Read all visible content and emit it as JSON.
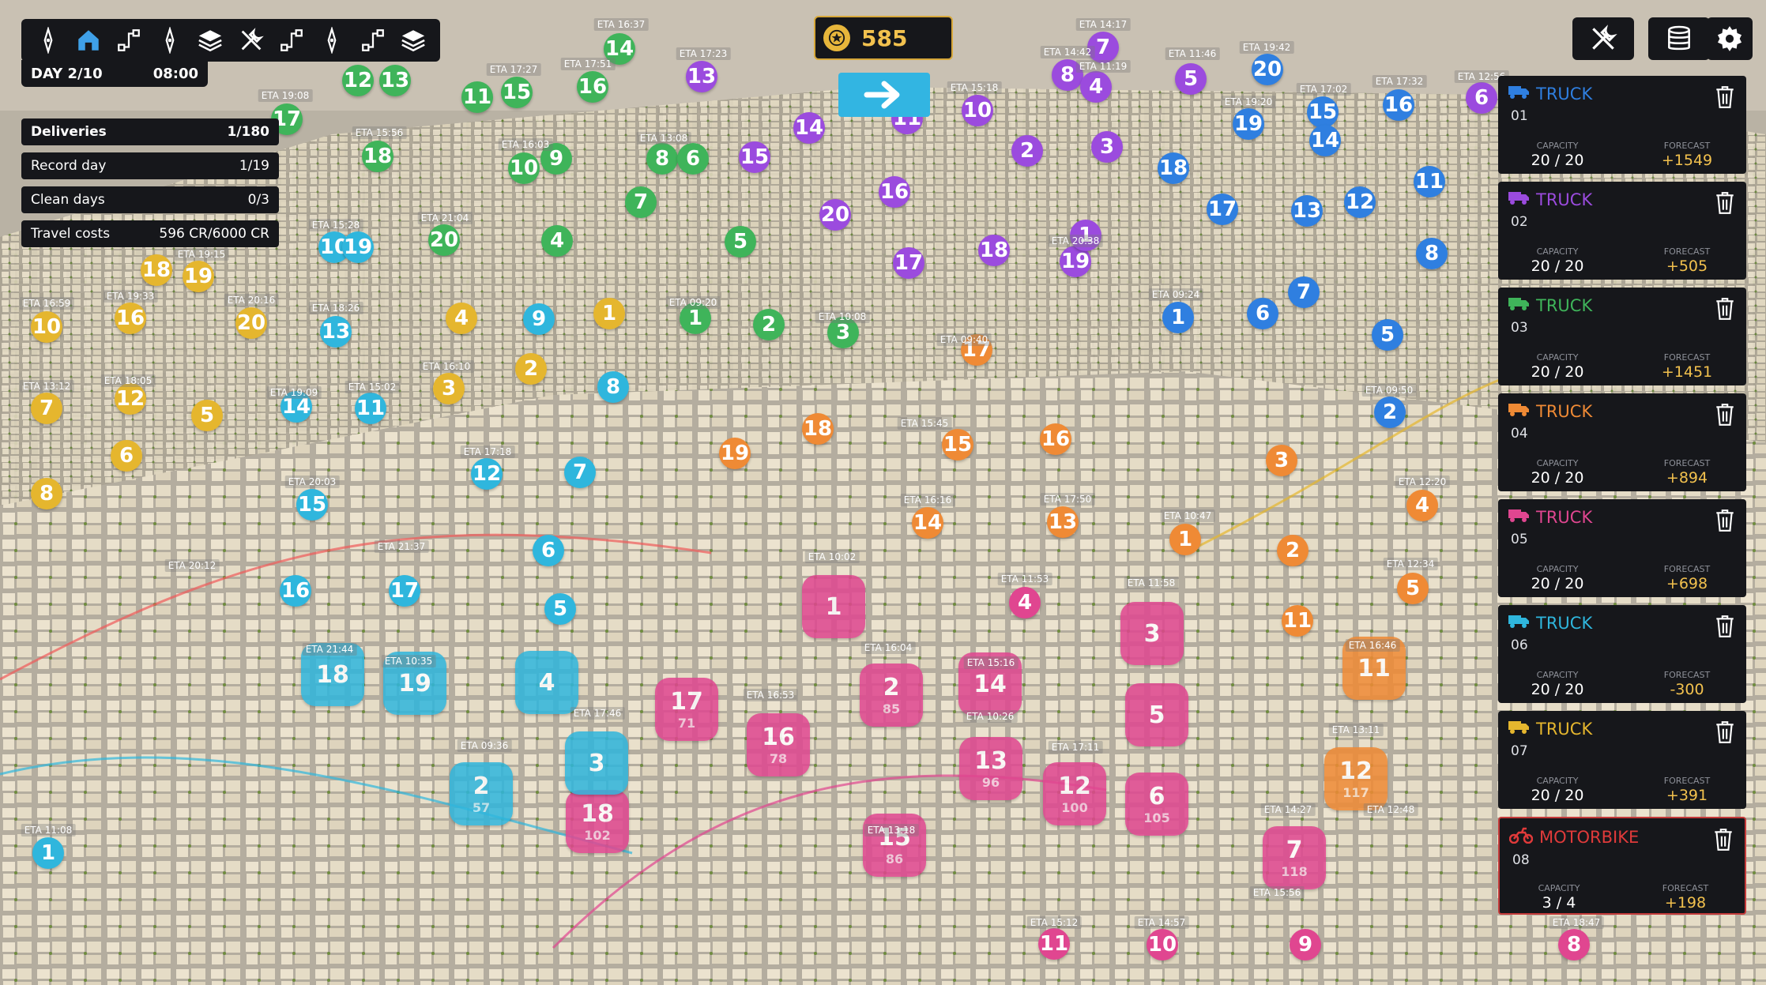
{
  "toolbar": {
    "icons": [
      "pin-icon",
      "home-icon",
      "route-icon",
      "pin-icon",
      "layers-icon",
      "tools-icon",
      "route-icon",
      "pin-icon",
      "route-icon",
      "layers-icon"
    ]
  },
  "day": {
    "label": "DAY 2/10",
    "time": "08:00"
  },
  "stats": [
    {
      "label": "Deliveries",
      "value": "1/180",
      "bold": true
    },
    {
      "label": "Record day",
      "value": "1/19"
    },
    {
      "label": "Clean days",
      "value": "0/3"
    },
    {
      "label": "Travel costs",
      "value": "596 CR/6000 CR"
    }
  ],
  "coins": {
    "value": "585"
  },
  "colors": {
    "blue": "#2f7fe0",
    "purple": "#9b4bde",
    "green": "#3fb45a",
    "yellow": "#e5b62e",
    "cyan": "#2fb6dd",
    "orange": "#ef8a35",
    "pink": "#e04690",
    "red": "#e03a3a",
    "panel": "#16171b",
    "gold": "#f2c14e"
  },
  "vehicles": [
    {
      "type": "TRUCK",
      "id": "01",
      "capacity": "20 / 20",
      "forecast": "+1549",
      "color": "#2f7fe0",
      "icon": "truck-icon"
    },
    {
      "type": "TRUCK",
      "id": "02",
      "capacity": "20 / 20",
      "forecast": "+505",
      "color": "#9b4bde",
      "icon": "truck-icon"
    },
    {
      "type": "TRUCK",
      "id": "03",
      "capacity": "20 / 20",
      "forecast": "+1451",
      "color": "#3fb45a",
      "icon": "truck-icon"
    },
    {
      "type": "TRUCK",
      "id": "04",
      "capacity": "20 / 20",
      "forecast": "+894",
      "color": "#ef8a35",
      "icon": "truck-icon"
    },
    {
      "type": "TRUCK",
      "id": "05",
      "capacity": "20 / 20",
      "forecast": "+698",
      "color": "#e04690",
      "icon": "truck-icon"
    },
    {
      "type": "TRUCK",
      "id": "06",
      "capacity": "20 / 20",
      "forecast": "-300",
      "color": "#2fb6dd",
      "icon": "truck-icon"
    },
    {
      "type": "TRUCK",
      "id": "07",
      "capacity": "20 / 20",
      "forecast": "+391",
      "color": "#e5b62e",
      "icon": "truck-icon"
    },
    {
      "type": "MOTORBIKE",
      "id": "08",
      "capacity": "3 / 4",
      "forecast": "+198",
      "color": "#e03a3a",
      "icon": "motorbike-icon",
      "selected": true
    }
  ],
  "vehicle_labels": {
    "capacity": "CAPACITY",
    "forecast": "FORECAST"
  },
  "markers": [
    {
      "n": "17",
      "c": "green"
    },
    {
      "n": "12",
      "c": "green"
    },
    {
      "n": "13",
      "c": "green"
    },
    {
      "n": "11",
      "c": "green"
    },
    {
      "n": "15",
      "c": "green"
    },
    {
      "n": "16",
      "c": "green"
    },
    {
      "n": "14",
      "c": "green"
    },
    {
      "n": "18",
      "c": "green"
    },
    {
      "n": "10",
      "c": "green"
    },
    {
      "n": "9",
      "c": "green"
    },
    {
      "n": "8",
      "c": "green"
    },
    {
      "n": "6",
      "c": "green"
    },
    {
      "n": "7",
      "c": "green"
    },
    {
      "n": "20",
      "c": "green"
    },
    {
      "n": "4",
      "c": "green"
    },
    {
      "n": "5",
      "c": "green"
    },
    {
      "n": "1",
      "c": "green"
    },
    {
      "n": "2",
      "c": "green"
    },
    {
      "n": "3",
      "c": "green"
    },
    {
      "n": "13",
      "c": "purple"
    },
    {
      "n": "14",
      "c": "purple"
    },
    {
      "n": "15",
      "c": "purple"
    },
    {
      "n": "10",
      "c": "purple"
    },
    {
      "n": "8",
      "c": "purple"
    },
    {
      "n": "7",
      "c": "purple"
    },
    {
      "n": "4",
      "c": "purple"
    },
    {
      "n": "5",
      "c": "purple"
    },
    {
      "n": "3",
      "c": "purple"
    },
    {
      "n": "2",
      "c": "purple"
    },
    {
      "n": "16",
      "c": "purple"
    },
    {
      "n": "20",
      "c": "purple"
    },
    {
      "n": "17",
      "c": "purple"
    },
    {
      "n": "18",
      "c": "purple"
    },
    {
      "n": "19",
      "c": "purple"
    },
    {
      "n": "6",
      "c": "purple"
    },
    {
      "n": "1",
      "c": "purple"
    },
    {
      "n": "11",
      "c": "purple"
    },
    {
      "n": "20",
      "c": "blue"
    },
    {
      "n": "19",
      "c": "blue"
    },
    {
      "n": "15",
      "c": "blue"
    },
    {
      "n": "14",
      "c": "blue"
    },
    {
      "n": "16",
      "c": "blue"
    },
    {
      "n": "18",
      "c": "blue"
    },
    {
      "n": "17",
      "c": "blue"
    },
    {
      "n": "13",
      "c": "blue"
    },
    {
      "n": "12",
      "c": "blue"
    },
    {
      "n": "11",
      "c": "blue"
    },
    {
      "n": "8",
      "c": "blue"
    },
    {
      "n": "7",
      "c": "blue"
    },
    {
      "n": "6",
      "c": "blue"
    },
    {
      "n": "1",
      "c": "blue"
    },
    {
      "n": "5",
      "c": "blue"
    },
    {
      "n": "2",
      "c": "blue"
    },
    {
      "n": "10",
      "c": "yellow"
    },
    {
      "n": "18",
      "c": "yellow"
    },
    {
      "n": "19",
      "c": "yellow"
    },
    {
      "n": "16",
      "c": "yellow"
    },
    {
      "n": "20",
      "c": "yellow"
    },
    {
      "n": "4",
      "c": "yellow"
    },
    {
      "n": "1",
      "c": "yellow"
    },
    {
      "n": "2",
      "c": "yellow"
    },
    {
      "n": "3",
      "c": "yellow"
    },
    {
      "n": "12",
      "c": "yellow"
    },
    {
      "n": "7",
      "c": "yellow"
    },
    {
      "n": "5",
      "c": "yellow"
    },
    {
      "n": "6",
      "c": "yellow"
    },
    {
      "n": "8",
      "c": "yellow"
    },
    {
      "n": "10",
      "c": "cyan"
    },
    {
      "n": "19",
      "c": "cyan"
    },
    {
      "n": "13",
      "c": "cyan"
    },
    {
      "n": "9",
      "c": "cyan"
    },
    {
      "n": "8",
      "c": "cyan"
    },
    {
      "n": "14",
      "c": "cyan"
    },
    {
      "n": "11",
      "c": "cyan"
    },
    {
      "n": "12",
      "c": "cyan"
    },
    {
      "n": "7",
      "c": "cyan"
    },
    {
      "n": "15",
      "c": "cyan"
    },
    {
      "n": "6",
      "c": "cyan"
    },
    {
      "n": "16",
      "c": "cyan"
    },
    {
      "n": "17",
      "c": "cyan"
    },
    {
      "n": "5",
      "c": "cyan"
    },
    {
      "n": "1",
      "c": "cyan"
    },
    {
      "n": "17",
      "c": "orange"
    },
    {
      "n": "18",
      "c": "orange"
    },
    {
      "n": "19",
      "c": "orange"
    },
    {
      "n": "15",
      "c": "orange"
    },
    {
      "n": "16",
      "c": "orange"
    },
    {
      "n": "14",
      "c": "orange"
    },
    {
      "n": "13",
      "c": "orange"
    },
    {
      "n": "3",
      "c": "orange"
    },
    {
      "n": "4",
      "c": "orange"
    },
    {
      "n": "1",
      "c": "orange"
    },
    {
      "n": "2",
      "c": "orange"
    },
    {
      "n": "5",
      "c": "orange"
    },
    {
      "n": "11",
      "c": "orange"
    },
    {
      "n": "4",
      "c": "pink"
    },
    {
      "n": "11",
      "c": "pink"
    },
    {
      "n": "10",
      "c": "pink"
    },
    {
      "n": "9",
      "c": "pink"
    },
    {
      "n": "8",
      "c": "pink"
    }
  ],
  "big_markers": [
    {
      "n": "1",
      "c": "pink",
      "sub": ""
    },
    {
      "n": "2",
      "c": "pink",
      "sub": "85"
    },
    {
      "n": "14",
      "c": "pink",
      "sub": ""
    },
    {
      "n": "3",
      "c": "pink",
      "sub": ""
    },
    {
      "n": "5",
      "c": "pink",
      "sub": ""
    },
    {
      "n": "17",
      "c": "pink",
      "sub": "71"
    },
    {
      "n": "16",
      "c": "pink",
      "sub": "78"
    },
    {
      "n": "13",
      "c": "pink",
      "sub": "96"
    },
    {
      "n": "12",
      "c": "pink",
      "sub": "100"
    },
    {
      "n": "6",
      "c": "pink",
      "sub": "105"
    },
    {
      "n": "18",
      "c": "pink",
      "sub": "102"
    },
    {
      "n": "15",
      "c": "pink",
      "sub": "86"
    },
    {
      "n": "7",
      "c": "pink",
      "sub": "118"
    },
    {
      "n": "2",
      "c": "cyan",
      "sub": "57"
    },
    {
      "n": "3",
      "c": "cyan",
      "sub": ""
    },
    {
      "n": "4",
      "c": "cyan",
      "sub": ""
    },
    {
      "n": "18",
      "c": "cyan",
      "sub": ""
    },
    {
      "n": "19",
      "c": "cyan",
      "sub": ""
    },
    {
      "n": "11",
      "c": "orange",
      "sub": ""
    },
    {
      "n": "12",
      "c": "orange",
      "sub": "117"
    }
  ],
  "eta_labels": [
    "ETA 16:37",
    "ETA 17:23",
    "ETA 14:17",
    "ETA 14:42",
    "ETA 11:19",
    "ETA 11:46",
    "ETA 19:42",
    "ETA 17:02",
    "ETA 17:32",
    "ETA 12:56",
    "ETA 19:20",
    "ETA 15:18",
    "ETA 19:08",
    "ETA 15:56",
    "ETA 17:27",
    "ETA 17:51",
    "ETA 13:08",
    "ETA 16:03",
    "ETA 15:28",
    "ETA 21:04",
    "ETA 19:33",
    "ETA 20:16",
    "ETA 18:26",
    "ETA 16:59",
    "ETA 19:15",
    "ETA 09:20",
    "ETA 09:50",
    "ETA 10:08",
    "ETA 16:10",
    "ETA 13:12",
    "ETA 18:05",
    "ETA 19:09",
    "ETA 15:02",
    "ETA 17:18",
    "ETA 20:03",
    "ETA 20:12",
    "ETA 21:37",
    "ETA 21:44",
    "ETA 10:35",
    "ETA 09:36",
    "ETA 11:08",
    "ETA 17:46",
    "ETA 16:53",
    "ETA 15:16",
    "ETA 10:26",
    "ETA 16:04",
    "ETA 17:11",
    "ETA 13:18",
    "ETA 14:27",
    "ETA 15:56",
    "ETA 14:57",
    "ETA 15:12",
    "ETA 10:02",
    "ETA 11:53",
    "ETA 11:58",
    "ETA 12:20",
    "ETA 12:34",
    "ETA 16:46",
    "ETA 13:11",
    "ETA 09:24",
    "ETA 12:48",
    "ETA 18:47",
    "ETA 20:38",
    "ETA 15:45",
    "ETA 10:47",
    "ETA 09:40",
    "ETA 17:50",
    "ETA 16:16"
  ]
}
